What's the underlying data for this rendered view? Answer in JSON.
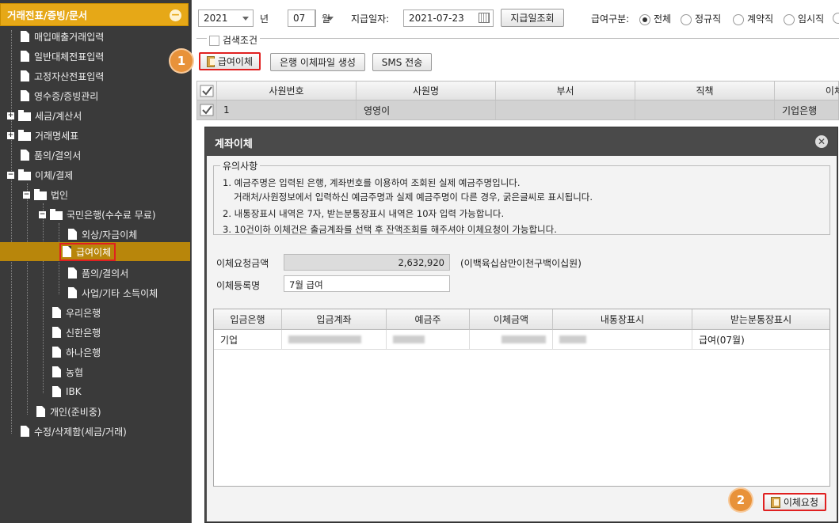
{
  "sidebar": {
    "header": "거래전표/증빙/문서",
    "items": [
      {
        "label": "매입매출거래입력"
      },
      {
        "label": "일반대체전표입력"
      },
      {
        "label": "고정자산전표입력"
      },
      {
        "label": "영수증/증빙관리"
      },
      {
        "label": "세금/계산서"
      },
      {
        "label": "거래명세표"
      },
      {
        "label": "품의/결의서"
      },
      {
        "label": "이체/결제"
      },
      {
        "label": "법인"
      },
      {
        "label": "국민은행(수수료 무료)"
      },
      {
        "label": "외상/자금이체"
      },
      {
        "label": "급여이체"
      },
      {
        "label": "품의/결의서"
      },
      {
        "label": "사업/기타 소득이체"
      },
      {
        "label": "우리은행"
      },
      {
        "label": "신한은행"
      },
      {
        "label": "하나은행"
      },
      {
        "label": "농협"
      },
      {
        "label": "IBK"
      },
      {
        "label": "개인(준비중)"
      },
      {
        "label": "수정/삭제함(세금/거래)"
      }
    ]
  },
  "toolbar": {
    "year": "2021",
    "year_suffix": "년",
    "month": "07",
    "month_suffix": "월",
    "pay_date_label": "지급일자:",
    "pay_date": "2021-07-23",
    "pay_date_search": "지급일조회",
    "pay_type_label": "급여구분:",
    "pay_types": [
      "전체",
      "정규직",
      "계약직",
      "임시직"
    ],
    "search_condition": "검색조건",
    "btn_payroll_transfer": "급여이체",
    "btn_bank_file": "은행 이체파일 생성",
    "btn_sms": "SMS 전송"
  },
  "grid": {
    "columns": [
      "사원번호",
      "사원명",
      "부서",
      "직책",
      "이체"
    ],
    "rows": [
      {
        "no": "1",
        "name": "영영이",
        "dept": "",
        "position": "",
        "bank": "기업은행"
      }
    ]
  },
  "badges": {
    "one": "1",
    "two": "2"
  },
  "modal": {
    "title": "계좌이체",
    "notice_title": "유의사항",
    "notices": [
      "1. 예금주명은 입력된 은행, 계좌번호를 이용하여 조회된 실제 예금주명입니다.",
      "거래처/사원정보에서 입력하신 예금주명과 실제 예금주명이 다른 경우, 굵은글씨로 표시됩니다.",
      "2. 내통장표시 내역은 7자, 받는분통장표시 내역은 10자 입력 가능합니다.",
      "3. 10건이하 이체건은 출금계좌를 선택 후 잔액조회를 해주셔야 이체요청이 가능합니다."
    ],
    "amount_label": "이체요청금액",
    "amount": "2,632,920",
    "amount_korean": "(이백육십삼만이천구백이십원)",
    "reg_name_label": "이체등록명",
    "reg_name": "7월 급여",
    "table": {
      "columns": [
        "입금은행",
        "입금계좌",
        "예금주",
        "이체금액",
        "내통장표시",
        "받는분통장표시"
      ],
      "rows": [
        {
          "bank": "기업",
          "memo_to": "급여(07월)"
        }
      ]
    },
    "request_button": "이체요청"
  }
}
